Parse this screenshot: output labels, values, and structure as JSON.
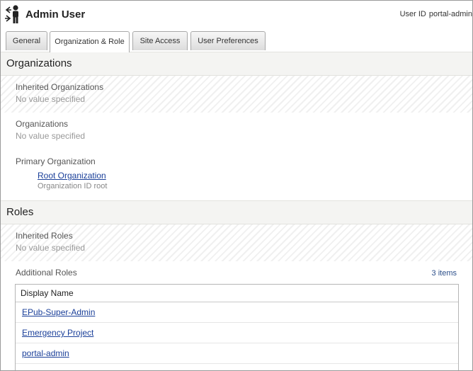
{
  "header": {
    "title": "Admin User",
    "user_id_label": "User ID",
    "user_id_value": "portal-admin",
    "icon": "user-swap-icon"
  },
  "tabs": [
    {
      "label": "General",
      "active": false
    },
    {
      "label": "Organization & Role",
      "active": true
    },
    {
      "label": "Site Access",
      "active": false
    },
    {
      "label": "User Preferences",
      "active": false
    }
  ],
  "organizations": {
    "title": "Organizations",
    "inherited_label": "Inherited Organizations",
    "inherited_value": "No value specified",
    "orgs_label": "Organizations",
    "orgs_value": "No value specified",
    "primary_label": "Primary Organization",
    "primary_link": "Root Organization",
    "primary_meta": "Organization  ID root"
  },
  "roles": {
    "title": "Roles",
    "inherited_label": "Inherited Roles",
    "inherited_value": "No value specified",
    "additional_label": "Additional Roles",
    "count": "3 items",
    "column_header": "Display Name",
    "items": [
      "EPub-Super-Admin",
      "Emergency Project",
      "portal-admin"
    ]
  },
  "colors": {
    "link": "#1a3f99",
    "section_bg": "#f4f4f2"
  }
}
